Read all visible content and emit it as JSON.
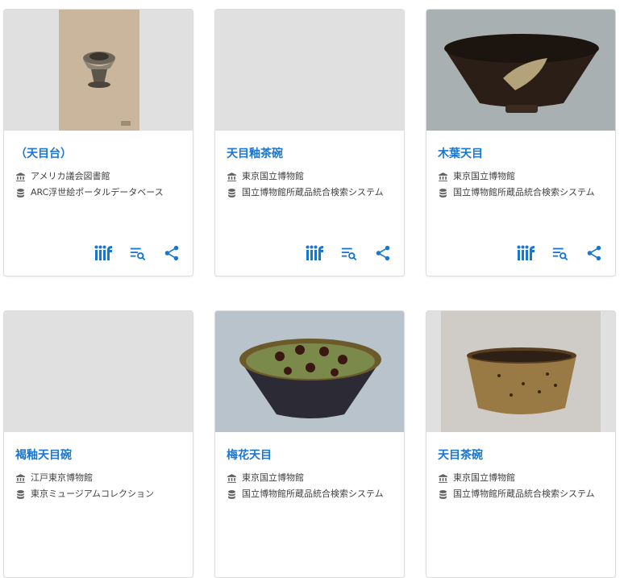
{
  "cards": [
    {
      "title": "（天目台）",
      "institution": "アメリカ議会図書館",
      "database": "ARC浮世絵ポータルデータベース",
      "has_image": true,
      "show_actions": true
    },
    {
      "title": "天目釉茶碗",
      "institution": "東京国立博物館",
      "database": "国立博物館所蔵品統合検索システム",
      "has_image": false,
      "show_actions": true
    },
    {
      "title": "木葉天目",
      "institution": "東京国立博物館",
      "database": "国立博物館所蔵品統合検索システム",
      "has_image": true,
      "show_actions": true
    },
    {
      "title": "褐釉天目碗",
      "institution": "江戸東京博物館",
      "database": "東京ミュージアムコレクション",
      "has_image": false,
      "show_actions": false
    },
    {
      "title": "梅花天目",
      "institution": "東京国立博物館",
      "database": "国立博物館所蔵品統合検索システム",
      "has_image": true,
      "show_actions": false
    },
    {
      "title": "天目茶碗",
      "institution": "東京国立博物館",
      "database": "国立博物館所蔵品統合検索システム",
      "has_image": true,
      "show_actions": false
    }
  ],
  "icons": {
    "iiif": "iiif-icon",
    "search": "list-search-icon",
    "share": "share-icon",
    "institution": "museum-icon",
    "database": "database-icon"
  },
  "colors": {
    "accent": "#1976d2",
    "placeholder": "#e0e0e0",
    "text": "#424242"
  }
}
